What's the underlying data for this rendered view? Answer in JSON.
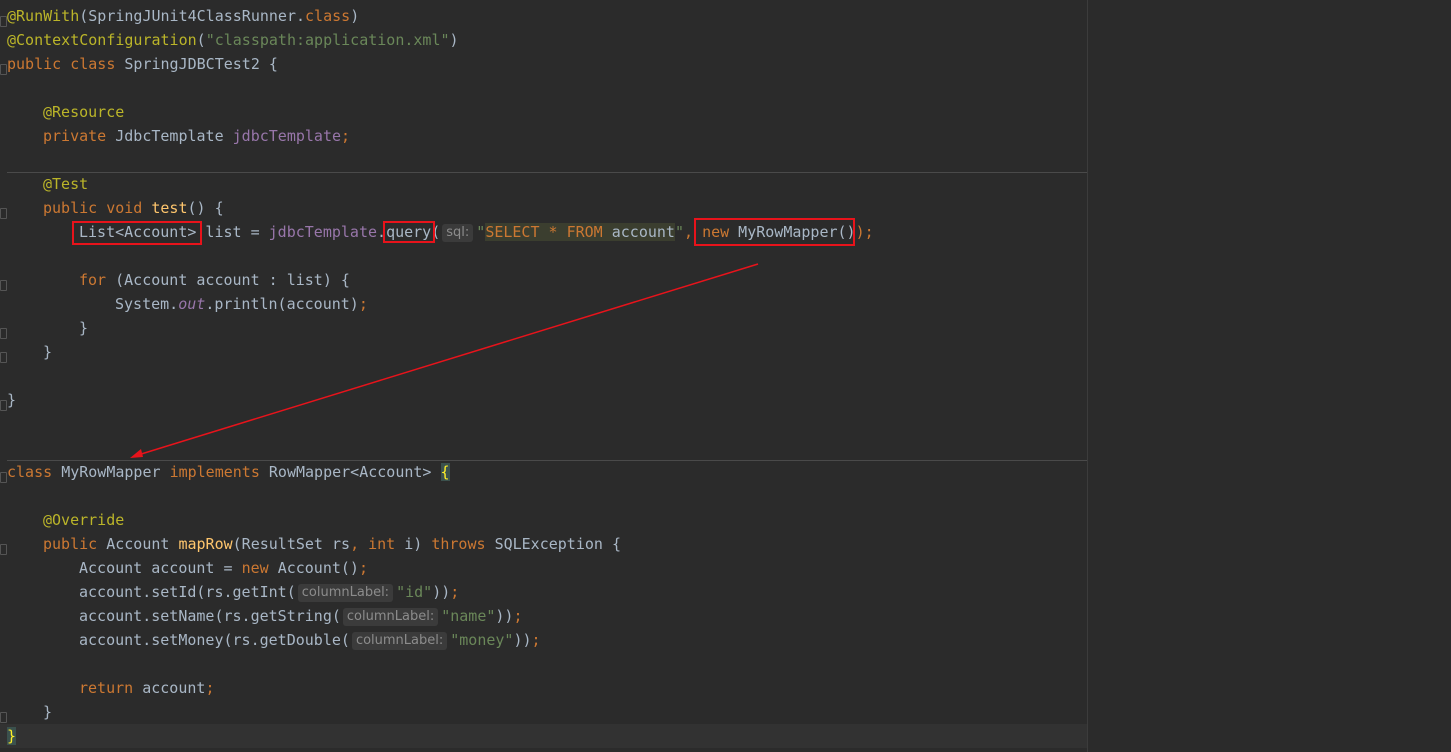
{
  "code": {
    "l1": {
      "ann": "@RunWith",
      "p1": "(SpringJUnit4ClassRunner.",
      "kw": "class",
      "p2": ")"
    },
    "l2": {
      "ann": "@ContextConfiguration",
      "p1": "(",
      "str": "\"classpath:application.xml\"",
      "p2": ")"
    },
    "l3": {
      "kw": "public class ",
      "name": "SpringJDBCTest2 {"
    },
    "l5": {
      "ann": "@Resource"
    },
    "l6": {
      "kw": "private ",
      "type": "JdbcTemplate ",
      "field": "jdbcTemplate",
      "semi": ";"
    },
    "l8": {
      "ann": "@Test"
    },
    "l9": {
      "kw": "public void ",
      "method": "test",
      "rest": "() {"
    },
    "l10": {
      "type": "List<Account>",
      "p1": " list = ",
      "field": "jdbcTemplate",
      "dot": ".",
      "call": "query",
      "open": "(",
      "hint": "sql:",
      "q1": "\"",
      "sql_kw1": "SELECT",
      "star": " * ",
      "sql_kw2": "FROM",
      "tbl": " account",
      "q2": "\"",
      "comma": ", ",
      "kw": "new",
      "ctor": " MyRowMapper()",
      "close": ");"
    },
    "l12": {
      "kw": "for",
      "rest": " (Account account : list) {"
    },
    "l13": {
      "p1": "System.",
      "sfield": "out",
      "p2": ".println(account)",
      "semi": ";"
    },
    "l14": {
      "text": "}"
    },
    "l15": {
      "text": "}"
    },
    "l17": {
      "text": "}"
    },
    "l20": {
      "kw1": "class ",
      "name": "MyRowMapper ",
      "kw2": "implements ",
      "iface": "RowMapper<Account> ",
      "brace": "{"
    },
    "l22": {
      "ann": "@Override"
    },
    "l23": {
      "kw": "public ",
      "type": "Account ",
      "method": "mapRow",
      "p1": "(ResultSet rs",
      "comma": ", ",
      "kw2": "int ",
      "p2": "i) ",
      "kw3": "throws ",
      "p3": "SQLException {"
    },
    "l24": {
      "p1": "Account account = ",
      "kw": "new ",
      "p2": "Account()",
      "semi": ";"
    },
    "l25": {
      "p1": "account.setId(rs.getInt(",
      "hint": "columnLabel:",
      "str": "\"id\"",
      "p2": "))",
      "semi": ";"
    },
    "l26": {
      "p1": "account.setName(rs.getString(",
      "hint": "columnLabel:",
      "str": "\"name\"",
      "p2": "))",
      "semi": ";"
    },
    "l27": {
      "p1": "account.setMoney(rs.getDouble(",
      "hint": "columnLabel:",
      "str": "\"money\"",
      "p2": "))",
      "semi": ";"
    },
    "l29": {
      "kw": "return ",
      "p1": "account",
      "semi": ";"
    },
    "l30": {
      "text": "}"
    },
    "l31": {
      "text": "}"
    }
  },
  "colors": {
    "background": "#2b2b2b",
    "keyword": "#cc7832",
    "string": "#6a8759",
    "annotation": "#bbb529",
    "field": "#9876aa",
    "method": "#ffc66d",
    "highlight_box": "#e8131b"
  }
}
